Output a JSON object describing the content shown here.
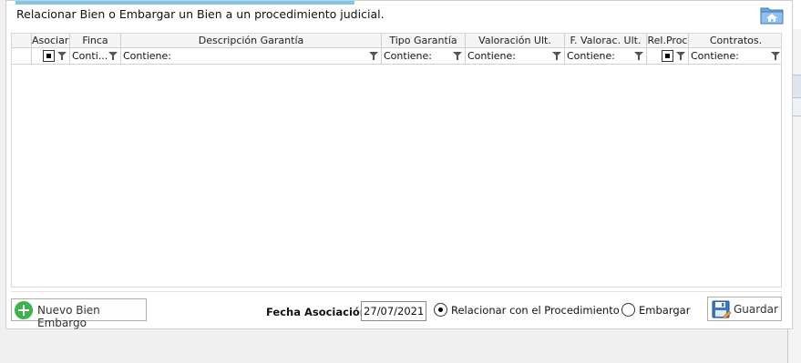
{
  "dialog": {
    "title": "Relacionar Bien o Embargar un Bien a un procedimiento judicial.",
    "home_icon": "home-folder-icon",
    "accent_color": "#7cc7ef"
  },
  "grid": {
    "columns": [
      {
        "header": "Asociar",
        "filter": "",
        "filter_kind": "checkbox"
      },
      {
        "header": "Finca",
        "filter": "Conti...",
        "filter_kind": "text"
      },
      {
        "header": "Descripción Garantía",
        "filter": "Contiene:",
        "filter_kind": "text"
      },
      {
        "header": "Tipo Garantía",
        "filter": "Contiene:",
        "filter_kind": "text"
      },
      {
        "header": "Valoración Ult.",
        "filter": "Contiene:",
        "filter_kind": "text"
      },
      {
        "header": "F. Valorac. Ult.",
        "filter": "Contiene:",
        "filter_kind": "text"
      },
      {
        "header": "Rel.Proc",
        "filter": "",
        "filter_kind": "checkbox"
      },
      {
        "header": "Contratos.",
        "filter": "Contiene:",
        "filter_kind": "text"
      }
    ],
    "rows": []
  },
  "footer": {
    "new_button_label": "Nuevo Bien Embargo",
    "fecha_label": "Fecha Asociación:",
    "fecha_value": "27/07/2021",
    "radio_relacionar_label": "Relacionar con el Procedimiento",
    "radio_embargar_label": "Embargar",
    "selected_option": "relacionar",
    "save_button_label": "Guardar"
  }
}
